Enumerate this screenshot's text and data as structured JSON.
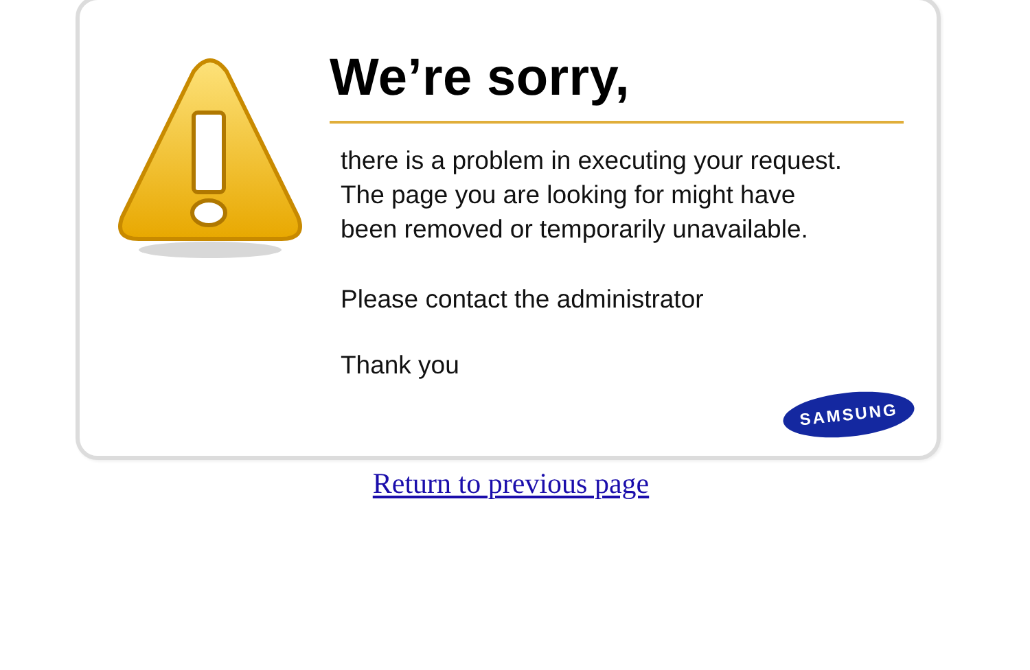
{
  "card": {
    "heading": "We’re sorry,",
    "message": [
      "there is a problem in executing your request.",
      "The page you are looking for might have",
      "been removed or temporarily unavailable."
    ],
    "contact": "Please contact the administrator",
    "thanks": "Thank you",
    "logo": "SAMSUNG"
  },
  "link": "Return to previous page"
}
